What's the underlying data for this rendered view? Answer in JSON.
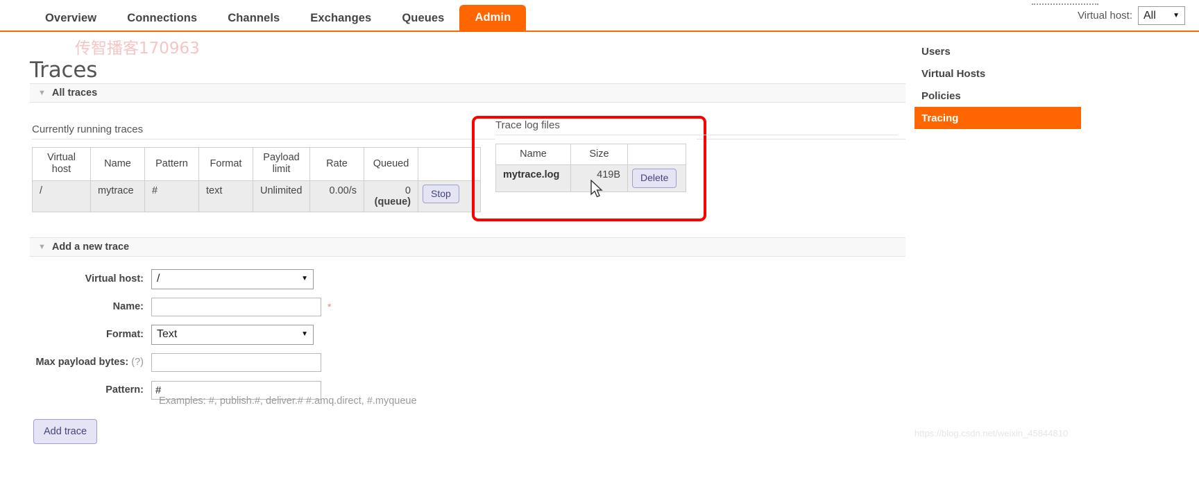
{
  "topnav": {
    "tabs": [
      {
        "label": "Overview",
        "active": false
      },
      {
        "label": "Connections",
        "active": false
      },
      {
        "label": "Channels",
        "active": false
      },
      {
        "label": "Exchanges",
        "active": false
      },
      {
        "label": "Queues",
        "active": false
      },
      {
        "label": "Admin",
        "active": true
      }
    ],
    "vhost_label": "Virtual host:",
    "vhost_value": "All",
    "caret": "▼",
    "accent_color": "#ff6600"
  },
  "page": {
    "title": "Traces",
    "watermark_top": "传智播客170963",
    "watermark_bottom": "https://blog.csdn.net/weixin_45844810"
  },
  "sections": {
    "all_traces": {
      "label": "All traces",
      "arrow": "▼"
    },
    "add_trace": {
      "label": "Add a new trace",
      "arrow": "▼"
    }
  },
  "running_traces": {
    "caption": "Currently running traces",
    "headers": [
      "Virtual host",
      "Name",
      "Pattern",
      "Format",
      "Payload limit",
      "Rate",
      "Queued",
      ""
    ],
    "rows": [
      {
        "vhost": "/",
        "name": "mytrace",
        "pattern": "#",
        "format": "text",
        "payload_limit": "Unlimited",
        "rate": "0.00/s",
        "queued_count": "0",
        "queued_note": "(queue)",
        "action_label": "Stop"
      }
    ]
  },
  "trace_log_files": {
    "caption": "Trace log files",
    "headers": [
      "Name",
      "Size",
      ""
    ],
    "rows": [
      {
        "name": "mytrace.log",
        "size": "419B",
        "action_label": "Delete"
      }
    ],
    "highlight_color": "#fe0000",
    "cursor": "mouse-pointer"
  },
  "add_trace_form": {
    "fields": {
      "vhost": {
        "label": "Virtual host:",
        "value": "/",
        "caret": "▼"
      },
      "name": {
        "label": "Name:",
        "value": "",
        "placeholder": "",
        "required_marker": "*"
      },
      "format": {
        "label": "Format:",
        "value": "Text",
        "caret": "▼"
      },
      "max_payload": {
        "label": "Max payload bytes:",
        "hint": "(?)",
        "value": "",
        "placeholder": ""
      },
      "pattern": {
        "label": "Pattern:",
        "value": "#",
        "placeholder": ""
      }
    },
    "examples": "Examples: #, publish.#, deliver.# #.amq.direct, #.myqueue",
    "submit_label": "Add trace"
  },
  "sidebar": {
    "items": [
      {
        "label": "Users",
        "active": false
      },
      {
        "label": "Virtual Hosts",
        "active": false
      },
      {
        "label": "Policies",
        "active": false
      },
      {
        "label": "Tracing",
        "active": true
      }
    ]
  }
}
